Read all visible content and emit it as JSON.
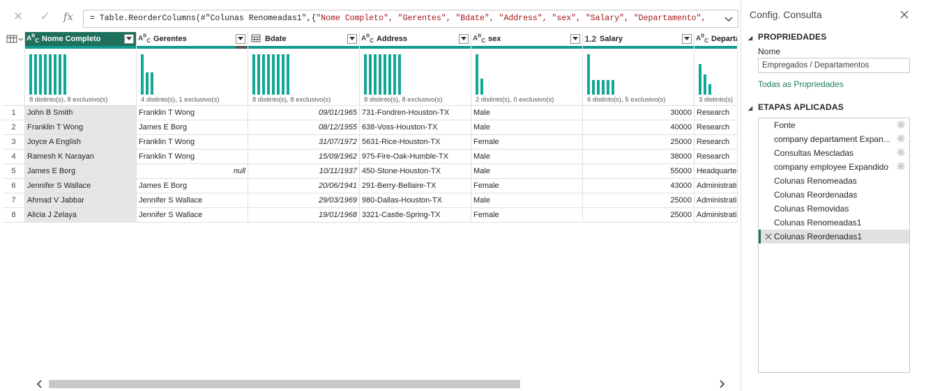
{
  "formula": {
    "cancel_icon": "✕",
    "commit_icon": "✓",
    "fx_label": "fx",
    "prefix": "= Table.ReorderColumns(#\"Colunas Renomeadas1\",{",
    "strings": "\"Nome Completo\", \"Gerentes\", \"Bdate\", \"Address\", \"sex\", \"Salary\", \"Departamento\","
  },
  "columns": [
    {
      "type_icon": "ABC",
      "name": "Nome Completo",
      "profile": "8 distinto(s), 8 exclusivo(s)",
      "bars": [
        1,
        1,
        1,
        1,
        1,
        1,
        1,
        1
      ],
      "selected": true
    },
    {
      "type_icon": "ABC",
      "name": "Gerentes",
      "profile": "4 distinto(s), 1 exclusivo(s)",
      "bars": [
        1,
        0.55,
        0.55,
        0
      ],
      "selected": false
    },
    {
      "type_icon": "cal",
      "name": "Bdate",
      "profile": "8 distinto(s), 8 exclusivo(s)",
      "bars": [
        1,
        1,
        1,
        1,
        1,
        1,
        1,
        1
      ],
      "selected": false
    },
    {
      "type_icon": "ABC",
      "name": "Address",
      "profile": "8 distinto(s), 8 exclusivo(s)",
      "bars": [
        1,
        1,
        1,
        1,
        1,
        1,
        1,
        1
      ],
      "selected": false
    },
    {
      "type_icon": "ABC",
      "name": "sex",
      "profile": "2 distinto(s), 0 exclusivo(s)",
      "bars": [
        1,
        0.4
      ],
      "selected": false
    },
    {
      "type_icon": "1.2",
      "name": "Salary",
      "profile": "6 distinto(s), 5 exclusivo(s)",
      "bars": [
        1,
        0.37,
        0.37,
        0.37,
        0.37,
        0.37
      ],
      "selected": false
    },
    {
      "type_icon": "ABC",
      "name": "Departa",
      "profile": "3 distinto(s)",
      "bars": [
        0.75,
        0.5,
        0.25
      ],
      "selected": false
    }
  ],
  "rows": [
    [
      "John B Smith",
      "Franklin T Wong",
      "09/01/1965",
      "731-Fondren-Houston-TX",
      "Male",
      "30000",
      "Research"
    ],
    [
      "Franklin T Wong",
      "James E Borg",
      "08/12/1955",
      "638-Voss-Houston-TX",
      "Male",
      "40000",
      "Research"
    ],
    [
      "Joyce A English",
      "Franklin T Wong",
      "31/07/1972",
      "5631-Rice-Houston-TX",
      "Female",
      "25000",
      "Research"
    ],
    [
      "Ramesh K Narayan",
      "Franklin T Wong",
      "15/09/1962",
      "975-Fire-Oak-Humble-TX",
      "Male",
      "38000",
      "Research"
    ],
    [
      "James E Borg",
      "null",
      "10/11/1937",
      "450-Stone-Houston-TX",
      "Male",
      "55000",
      "Headquarte"
    ],
    [
      "Jennifer S Wallace",
      "James E Borg",
      "20/06/1941",
      "291-Berry-Bellaire-TX",
      "Female",
      "43000",
      "Administrati"
    ],
    [
      "Ahmad V Jabbar",
      "Jennifer S Wallace",
      "29/03/1969",
      "980-Dallas-Houston-TX",
      "Male",
      "25000",
      "Administrati"
    ],
    [
      "Alicia J Zelaya",
      "Jennifer S Wallace",
      "19/01/1968",
      "3321-Castle-Spring-TX",
      "Female",
      "25000",
      "Administrati"
    ]
  ],
  "row_numbers": [
    "1",
    "2",
    "3",
    "4",
    "5",
    "6",
    "7",
    "8"
  ],
  "pane": {
    "title": "Config. Consulta",
    "properties_head": "PROPRIEDADES",
    "name_label": "Nome",
    "name_value": "Empregados / Departamentos",
    "all_props_link": "Todas as Propriedades",
    "steps_head": "ETAPAS APLICADAS",
    "steps": [
      {
        "label": "Fonte",
        "gear": true
      },
      {
        "label": "company departament Expan...",
        "gear": true
      },
      {
        "label": "Consultas Mescladas",
        "gear": true
      },
      {
        "label": "company employee Expandido",
        "gear": true
      },
      {
        "label": "Colunas Renomeadas",
        "gear": false
      },
      {
        "label": "Colunas Reordenadas",
        "gear": false
      },
      {
        "label": "Colunas Removidas",
        "gear": false
      },
      {
        "label": "Colunas Renomeadas1",
        "gear": false
      },
      {
        "label": "Colunas Reordenadas1",
        "gear": false,
        "active": true
      }
    ]
  },
  "colors": {
    "accent": "#1e6f5c",
    "quality_bar": "#0f9b8e",
    "profile_bar": "#11a795"
  }
}
